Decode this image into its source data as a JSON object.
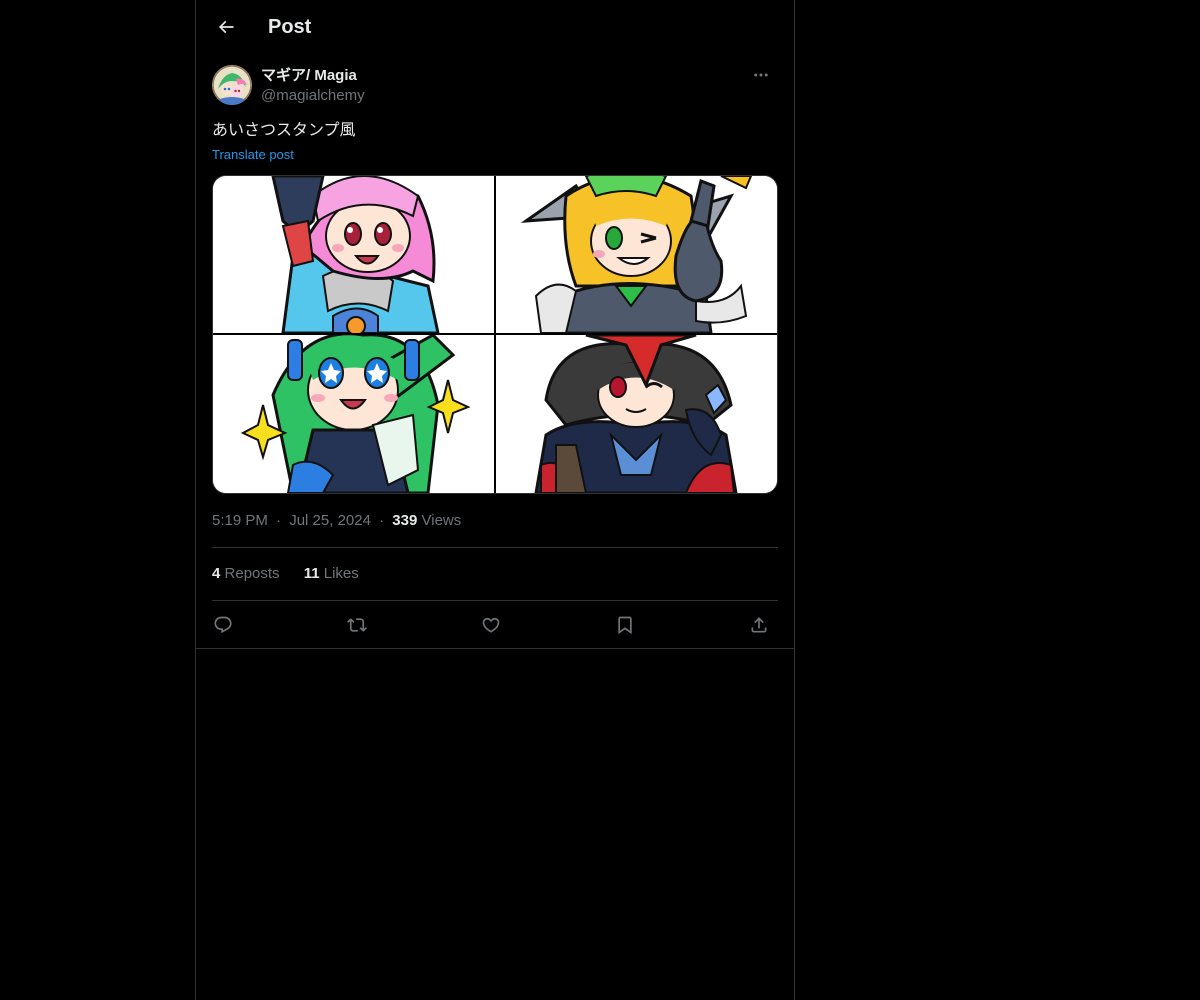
{
  "header": {
    "title": "Post",
    "back_icon": "arrow-left-icon"
  },
  "author": {
    "display_name": "マギア/ Magia",
    "handle": "@magialchemy",
    "more_icon": "more-horizontal-icon"
  },
  "post": {
    "text": "あいさつスタンプ風",
    "translate_label": "Translate post",
    "media_count": 4
  },
  "meta": {
    "time": "5:19 PM",
    "separator": "·",
    "date": "Jul 25, 2024",
    "views_count": "339",
    "views_label": "Views"
  },
  "stats": {
    "reposts_count": "4",
    "reposts_label": "Reposts",
    "likes_count": "11",
    "likes_label": "Likes"
  },
  "actions": [
    {
      "icon": "reply-icon"
    },
    {
      "icon": "repost-icon"
    },
    {
      "icon": "like-icon"
    },
    {
      "icon": "bookmark-icon"
    },
    {
      "icon": "share-icon"
    }
  ],
  "colors": {
    "background": "#000000",
    "text_primary": "#e7e9ea",
    "text_secondary": "#71767b",
    "accent": "#1d9bf0",
    "border": "#2f3336"
  }
}
